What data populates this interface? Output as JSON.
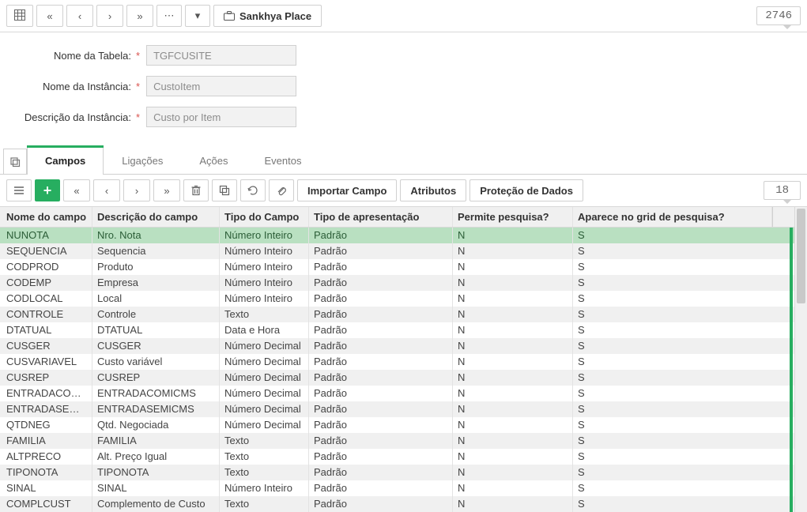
{
  "top": {
    "place_label": "Sankhya Place",
    "count": "2746"
  },
  "form": {
    "nome_tabela_label": "Nome da Tabela:",
    "nome_tabela_value": "TGFCUSITE",
    "nome_instancia_label": "Nome da Instância:",
    "nome_instancia_value": "CustoItem",
    "descricao_instancia_label": "Descrição da Instância:",
    "descricao_instancia_value": "Custo por Item"
  },
  "tabs": {
    "campos": "Campos",
    "ligacoes": "Ligações",
    "acoes": "Ações",
    "eventos": "Eventos"
  },
  "subtoolbar": {
    "importar": "Importar Campo",
    "atributos": "Atributos",
    "protecao": "Proteção de Dados",
    "count": "18"
  },
  "grid": {
    "headers": {
      "nome": "Nome do campo",
      "descricao": "Descrição do campo",
      "tipo": "Tipo do Campo",
      "apresentacao": "Tipo de apresentação",
      "pesquisa": "Permite pesquisa?",
      "gridpesq": "Aparece no grid de pesquisa?"
    },
    "rows": [
      {
        "nome": "NUNOTA",
        "descricao": "Nro. Nota",
        "tipo": "Número Inteiro",
        "apres": "Padrão",
        "perm": "N",
        "grid": "S"
      },
      {
        "nome": "SEQUENCIA",
        "descricao": "Sequencia",
        "tipo": "Número Inteiro",
        "apres": "Padrão",
        "perm": "N",
        "grid": "S"
      },
      {
        "nome": "CODPROD",
        "descricao": "Produto",
        "tipo": "Número Inteiro",
        "apres": "Padrão",
        "perm": "N",
        "grid": "S"
      },
      {
        "nome": "CODEMP",
        "descricao": "Empresa",
        "tipo": "Número Inteiro",
        "apres": "Padrão",
        "perm": "N",
        "grid": "S"
      },
      {
        "nome": "CODLOCAL",
        "descricao": "Local",
        "tipo": "Número Inteiro",
        "apres": "Padrão",
        "perm": "N",
        "grid": "S"
      },
      {
        "nome": "CONTROLE",
        "descricao": "Controle",
        "tipo": "Texto",
        "apres": "Padrão",
        "perm": "N",
        "grid": "S"
      },
      {
        "nome": "DTATUAL",
        "descricao": "DTATUAL",
        "tipo": "Data e Hora",
        "apres": "Padrão",
        "perm": "N",
        "grid": "S"
      },
      {
        "nome": "CUSGER",
        "descricao": "CUSGER",
        "tipo": "Número Decimal",
        "apres": "Padrão",
        "perm": "N",
        "grid": "S"
      },
      {
        "nome": "CUSVARIAVEL",
        "descricao": "Custo variável",
        "tipo": "Número Decimal",
        "apres": "Padrão",
        "perm": "N",
        "grid": "S"
      },
      {
        "nome": "CUSREP",
        "descricao": "CUSREP",
        "tipo": "Número Decimal",
        "apres": "Padrão",
        "perm": "N",
        "grid": "S"
      },
      {
        "nome": "ENTRADACOMICMS",
        "descricao": "ENTRADACOMICMS",
        "tipo": "Número Decimal",
        "apres": "Padrão",
        "perm": "N",
        "grid": "S"
      },
      {
        "nome": "ENTRADASEMICMS",
        "descricao": "ENTRADASEMICMS",
        "tipo": "Número Decimal",
        "apres": "Padrão",
        "perm": "N",
        "grid": "S"
      },
      {
        "nome": "QTDNEG",
        "descricao": "Qtd. Negociada",
        "tipo": "Número Decimal",
        "apres": "Padrão",
        "perm": "N",
        "grid": "S"
      },
      {
        "nome": "FAMILIA",
        "descricao": "FAMILIA",
        "tipo": "Texto",
        "apres": "Padrão",
        "perm": "N",
        "grid": "S"
      },
      {
        "nome": "ALTPRECO",
        "descricao": "Alt. Preço Igual",
        "tipo": "Texto",
        "apres": "Padrão",
        "perm": "N",
        "grid": "S"
      },
      {
        "nome": "TIPONOTA",
        "descricao": "TIPONOTA",
        "tipo": "Texto",
        "apres": "Padrão",
        "perm": "N",
        "grid": "S"
      },
      {
        "nome": "SINAL",
        "descricao": "SINAL",
        "tipo": "Número Inteiro",
        "apres": "Padrão",
        "perm": "N",
        "grid": "S"
      },
      {
        "nome": "COMPLCUST",
        "descricao": "Complemento de Custo",
        "tipo": "Texto",
        "apres": "Padrão",
        "perm": "N",
        "grid": "S"
      }
    ]
  }
}
